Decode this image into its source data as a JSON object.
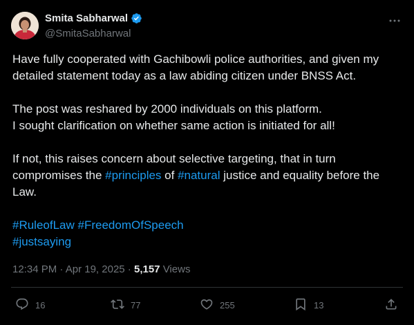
{
  "author": {
    "display_name": "Smita Sabharwal",
    "handle": "@SmitaSabharwal",
    "verified": true
  },
  "post": {
    "paragraphs": [
      {
        "lines": [
          [
            {
              "text": "Have fully cooperated with  Gachibowli police authorities, and given my",
              "hashtag": false
            }
          ],
          [
            {
              "text": "detailed statement today as a law abiding citizen under BNSS Act.",
              "hashtag": false
            }
          ]
        ]
      },
      {
        "lines": [
          [
            {
              "text": "The post was reshared by 2000 individuals on this platform.",
              "hashtag": false
            }
          ],
          [
            {
              "text": "I sought clarification on whether same action is initiated for all!",
              "hashtag": false
            }
          ]
        ]
      },
      {
        "lines": [
          [
            {
              "text": "If not, this raises concern about selective targeting, that in turn",
              "hashtag": false
            }
          ],
          [
            {
              "text": "compromises the ",
              "hashtag": false
            },
            {
              "text": "#principles",
              "hashtag": true
            },
            {
              "text": " of ",
              "hashtag": false
            },
            {
              "text": "#natural",
              "hashtag": true
            },
            {
              "text": " justice and equality before the",
              "hashtag": false
            }
          ],
          [
            {
              "text": "Law.",
              "hashtag": false
            }
          ]
        ]
      },
      {
        "lines": [
          [
            {
              "text": "#RuleofLaw",
              "hashtag": true
            },
            {
              "text": " ",
              "hashtag": false
            },
            {
              "text": "#FreedomOfSpeech",
              "hashtag": true
            }
          ],
          [
            {
              "text": "#justsaying",
              "hashtag": true
            }
          ]
        ]
      }
    ]
  },
  "meta": {
    "time": "12:34 PM",
    "separator": " · ",
    "date": "Apr 19, 2025",
    "views_count": "5,157",
    "views_label": " Views"
  },
  "actions": {
    "replies": "16",
    "reposts": "77",
    "likes": "255",
    "bookmarks": "13"
  },
  "colors": {
    "background": "#000000",
    "text": "#e7e9ea",
    "secondary": "#71767b",
    "accent": "#1d9bf0",
    "divider": "#2f3336"
  },
  "icons": [
    "verified-badge-icon",
    "more-icon",
    "reply-icon",
    "repost-icon",
    "like-icon",
    "bookmark-icon",
    "share-icon"
  ]
}
